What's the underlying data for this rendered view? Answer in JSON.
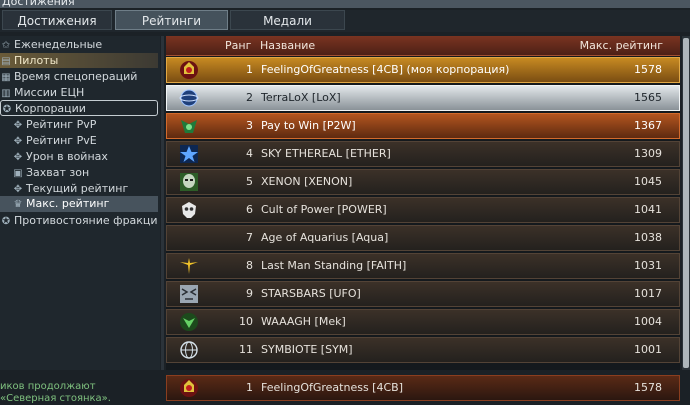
{
  "window": {
    "title": "Достижения"
  },
  "tabs": [
    "Достижения",
    "Рейтинги",
    "Медали"
  ],
  "sidebar": {
    "items": [
      {
        "label": "Еженедельные",
        "icon": "star-icon",
        "glyph": "✩"
      },
      {
        "label": "Пилоты",
        "icon": "pilot-icon",
        "glyph": "▤"
      },
      {
        "label": "Время спецопераций",
        "icon": "time-icon",
        "glyph": "▦"
      },
      {
        "label": "Миссии ЕЦН",
        "icon": "mission-icon",
        "glyph": "▥"
      },
      {
        "label": "Корпорации",
        "icon": "corporation-icon",
        "glyph": "✪"
      },
      {
        "label": "Рейтинг PvP",
        "icon": "pvp-icon",
        "glyph": "✥"
      },
      {
        "label": "Рейтинг PvE",
        "icon": "pve-icon",
        "glyph": "✥"
      },
      {
        "label": "Урон в войнах",
        "icon": "damage-icon",
        "glyph": "✥"
      },
      {
        "label": "Захват зон",
        "icon": "capture-icon",
        "glyph": "▣"
      },
      {
        "label": "Текущий рейтинг",
        "icon": "current-rating-icon",
        "glyph": "✥"
      },
      {
        "label": "Макс. рейтинг",
        "icon": "max-rating-icon",
        "glyph": "♛"
      },
      {
        "label": "Противостояние фракций",
        "icon": "factions-icon",
        "glyph": "✪"
      }
    ]
  },
  "table": {
    "headers": {
      "rank": "Ранг",
      "name": "Название",
      "rating": "Макс. рейтинг"
    },
    "rows": [
      {
        "rank": "1",
        "name": "FeelingOfGreatness [4CB] (моя корпорация)",
        "rating": "1578",
        "icon": "crimson-skull-emblem-icon"
      },
      {
        "rank": "2",
        "name": "TerraLoX [LoX]",
        "rating": "1565",
        "icon": "planet-emblem-icon"
      },
      {
        "rank": "3",
        "name": "Pay to Win [P2W]",
        "rating": "1367",
        "icon": "green-demon-emblem-icon"
      },
      {
        "rank": "4",
        "name": "SKY ETHEREAL [ETHER]",
        "rating": "1309",
        "icon": "blue-star-emblem-icon"
      },
      {
        "rank": "5",
        "name": "XENON [XENON]",
        "rating": "1045",
        "icon": "alien-emblem-icon"
      },
      {
        "rank": "6",
        "name": "Cult of Power [POWER]",
        "rating": "1041",
        "icon": "white-skull-emblem-icon"
      },
      {
        "rank": "7",
        "name": "Age of Aquarius [Aqua]",
        "rating": "1038",
        "icon": ""
      },
      {
        "rank": "8",
        "name": "Last Man Standing [FAITH]",
        "rating": "1031",
        "icon": "winged-emblem-icon"
      },
      {
        "rank": "9",
        "name": "STARSBARS [UFO]",
        "rating": "1017",
        "icon": "tiger-emblem-icon"
      },
      {
        "rank": "10",
        "name": "WAAAGH [Mek]",
        "rating": "1004",
        "icon": "green-orc-emblem-icon"
      },
      {
        "rank": "11",
        "name": "SYMBIOTE [SYM]",
        "rating": "1001",
        "icon": "globe-emblem-icon"
      }
    ],
    "own_row": {
      "rank": "1",
      "name": "FeelingOfGreatness [4CB]",
      "rating": "1578",
      "icon": "crimson-skull-emblem-icon"
    }
  },
  "notification": {
    "line1": "иков продолжают",
    "line2": "«Северная стоянка»."
  },
  "colors": {
    "gold": "#c78a22",
    "silver": "#e2e7ea",
    "bronze": "#b3551f",
    "header": "#7a3421",
    "selected_sidebar": "#47535d"
  }
}
